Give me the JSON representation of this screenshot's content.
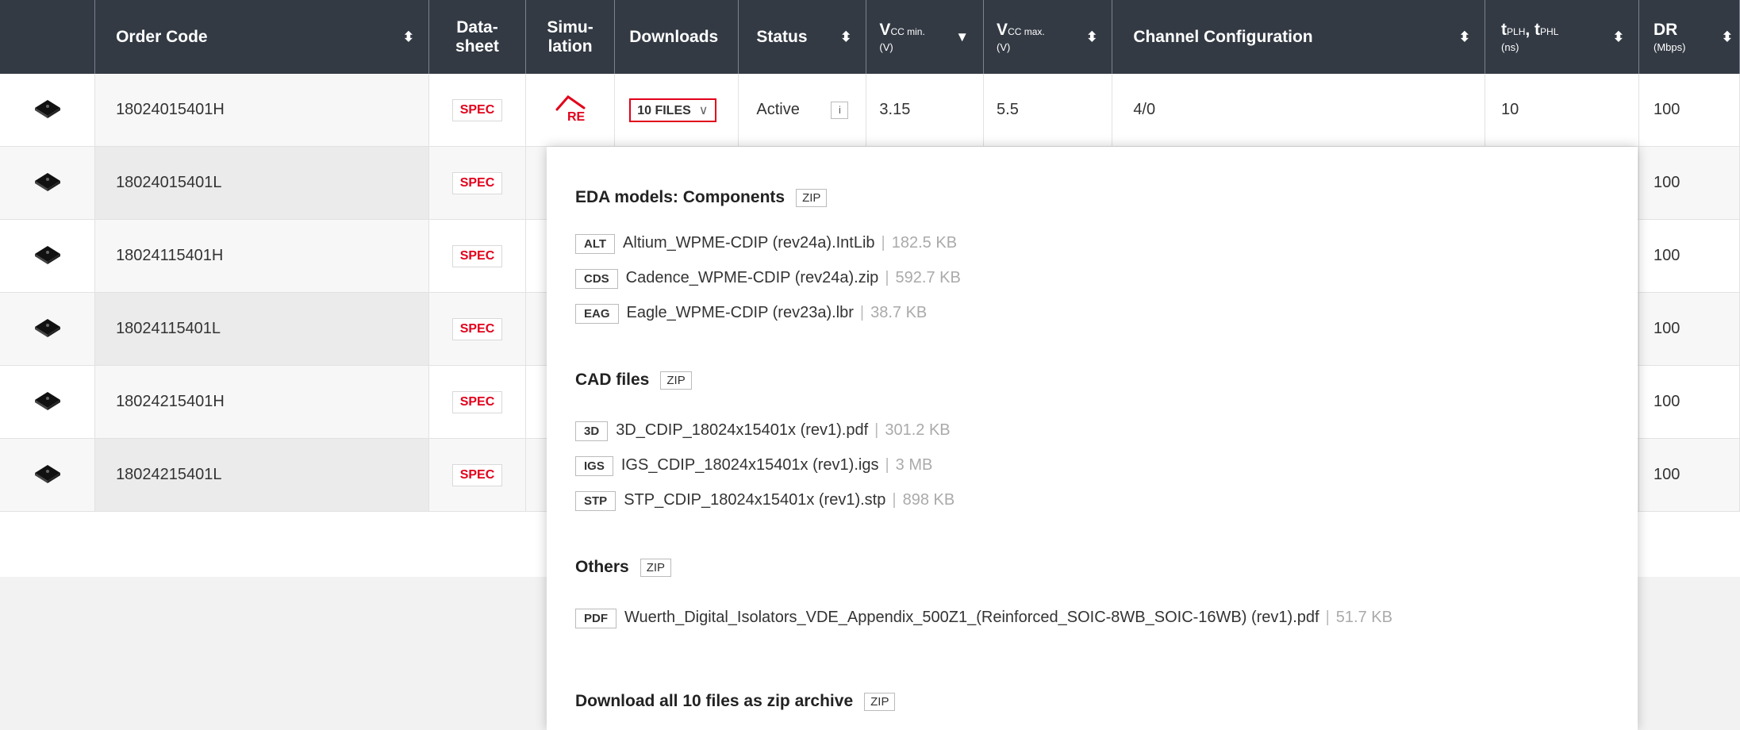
{
  "table": {
    "headers": {
      "order_code": "Order Code",
      "datasheet": [
        "Data-",
        "sheet"
      ],
      "simulation": [
        "Simu-",
        "lation"
      ],
      "downloads": "Downloads",
      "status": "Status",
      "vcc_min": {
        "main": "V",
        "sub": "CC min.",
        "unit": "(V)"
      },
      "vcc_max": {
        "main": "V",
        "sub": "CC max.",
        "unit": "(V)"
      },
      "channel_config": "Channel Configuration",
      "tplh": {
        "main": "t",
        "sub1": "PLH",
        "sep": ", t",
        "sub2": "PHL",
        "unit": "(ns)"
      },
      "dr": {
        "main": "DR",
        "unit": "(Mbps)"
      }
    },
    "rows": [
      {
        "order_code": "18024015401H",
        "datasheet": "SPEC",
        "downloads": "10 FILES",
        "status": "Active",
        "info": "i",
        "vcc_min": "3.15",
        "vcc_max": "5.5",
        "channel_config": "4/0",
        "tplh": "10",
        "dr": "100"
      },
      {
        "order_code": "18024015401L",
        "datasheet": "SPEC",
        "dr": "100"
      },
      {
        "order_code": "18024115401H",
        "datasheet": "SPEC",
        "dr": "100"
      },
      {
        "order_code": "18024115401L",
        "datasheet": "SPEC",
        "dr": "100"
      },
      {
        "order_code": "18024215401H",
        "datasheet": "SPEC",
        "dr": "100"
      },
      {
        "order_code": "18024215401L",
        "datasheet": "SPEC",
        "dr": "100"
      }
    ],
    "dr_visible_partial": "00"
  },
  "dropdown": {
    "groups": [
      {
        "title": "EDA models: Components",
        "zip": "ZIP",
        "files": [
          {
            "tag": "ALT",
            "name": "Altium_WPME-CDIP (rev24a).IntLib",
            "size": "182.5 KB"
          },
          {
            "tag": "CDS",
            "name": "Cadence_WPME-CDIP (rev24a).zip",
            "size": "592.7 KB"
          },
          {
            "tag": "EAG",
            "name": "Eagle_WPME-CDIP (rev23a).lbr",
            "size": "38.7 KB"
          }
        ]
      },
      {
        "title": "CAD files",
        "zip": "ZIP",
        "files": [
          {
            "tag": "3D",
            "name": "3D_CDIP_18024x15401x (rev1).pdf",
            "size": "301.2 KB"
          },
          {
            "tag": "IGS",
            "name": "IGS_CDIP_18024x15401x (rev1).igs",
            "size": "3 MB"
          },
          {
            "tag": "STP",
            "name": "STP_CDIP_18024x15401x (rev1).stp",
            "size": "898 KB"
          }
        ]
      },
      {
        "title": "Others",
        "zip": "ZIP",
        "files": [
          {
            "tag": "PDF",
            "name": "Wuerth_Digital_Isolators_VDE_Appendix_500Z1_(Reinforced_SOIC-8WB_SOIC-16WB) (rev1).pdf",
            "size": "51.7 KB"
          }
        ]
      }
    ],
    "download_all": "Download all 10 files as zip archive",
    "download_all_zip": "ZIP"
  },
  "colors": {
    "header_bg": "#333a44",
    "accent_red": "#e2001a"
  },
  "icons": {
    "product": "chip-icon",
    "simulation": "redexpert-icon",
    "sort": "sort-icon",
    "sort_desc": "sort-desc-icon",
    "chevron": "chevron-down-icon"
  }
}
